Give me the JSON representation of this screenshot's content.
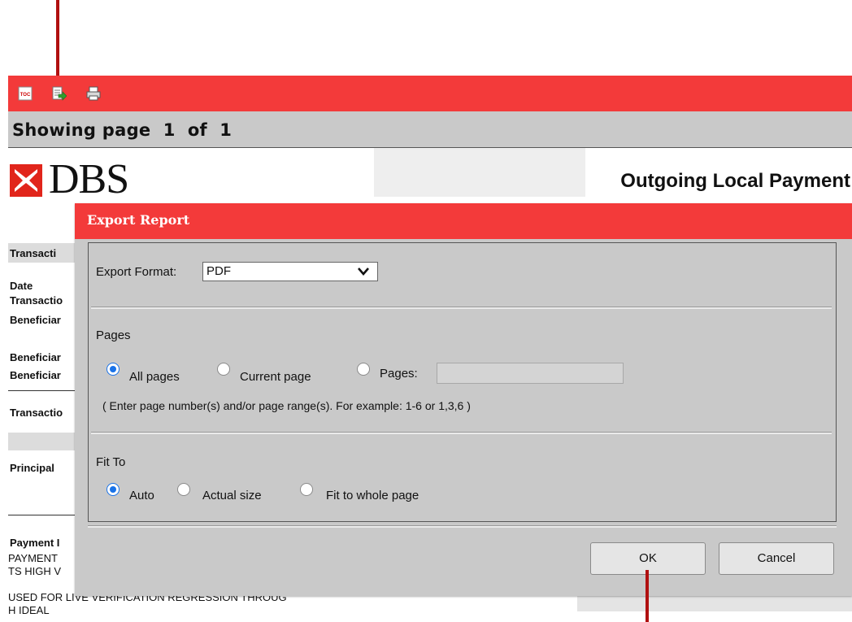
{
  "toolbar": {
    "icons": [
      "toc-icon",
      "export-icon",
      "print-icon"
    ],
    "toc_icon_text": "TOC"
  },
  "status": {
    "page_text": "Showing page  1  of  1"
  },
  "report": {
    "logo_text": "DBS",
    "title": "Outgoing Local Payment",
    "labels": [
      "Transacti",
      "Date",
      "Transactio",
      "Beneficiar",
      "Beneficiar",
      "Beneficiar",
      "Transactio",
      "Principal",
      "Payment I"
    ],
    "payment_text_lines": [
      "PAYMENT",
      "TS HIGH V",
      "USED FOR LIVE VERIFICATION REGRESSION THROUG",
      "H IDEAL"
    ]
  },
  "dialog": {
    "title": "Export Report",
    "export_format_label": "Export Format:",
    "export_format_value": "PDF",
    "pages_heading": "Pages",
    "pages_options": [
      "All pages",
      "Current page",
      "Pages:"
    ],
    "pages_selected": "All pages",
    "pages_input_value": "",
    "pages_hint": "( Enter page number(s) and/or page range(s). For example: 1-6 or 1,3,6 )",
    "fit_to_heading": "Fit To",
    "fit_options": [
      "Auto",
      "Actual size",
      "Fit to whole page"
    ],
    "fit_selected": "Auto",
    "ok_label": "OK",
    "cancel_label": "Cancel"
  },
  "colors": {
    "brand_red": "#f33a3a",
    "panel_gray": "#c9c9c9",
    "radio_blue": "#1a73e8",
    "annotation": "#b01010"
  }
}
